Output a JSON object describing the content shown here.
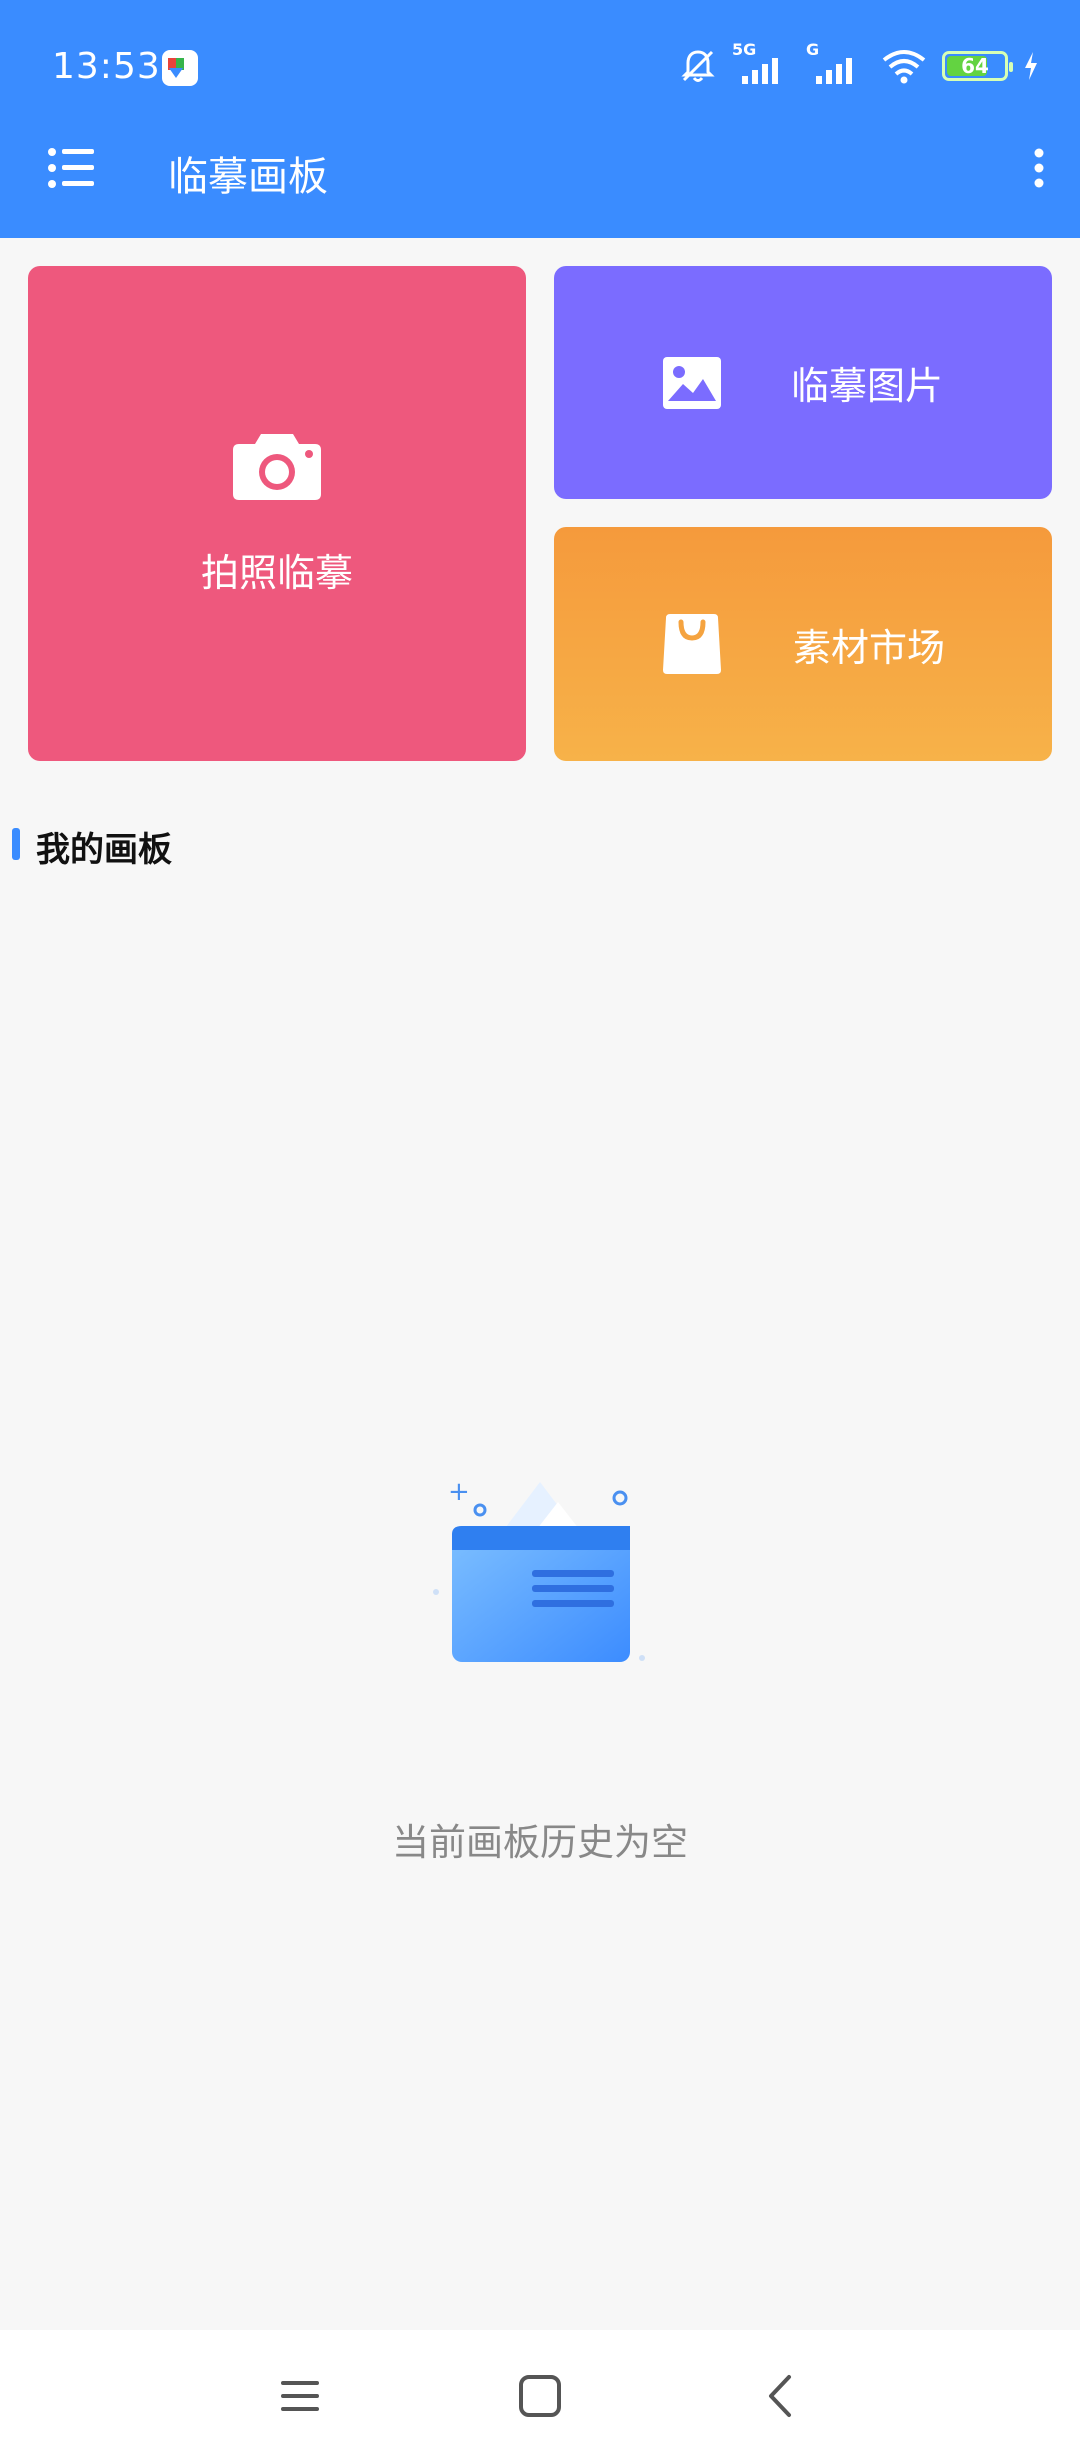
{
  "status_bar": {
    "time": "13:53",
    "network_primary": "5G",
    "network_secondary": "G",
    "battery_level": "64",
    "icons": [
      "app-notification-icon",
      "mute-bell-icon",
      "signal-icon",
      "wifi-icon",
      "battery-icon",
      "charging-icon"
    ]
  },
  "app_bar": {
    "title": "临摹画板",
    "menu_icon": "list-menu-icon",
    "more_icon": "more-vertical-icon"
  },
  "cards": {
    "camera_label": "拍照临摹",
    "image_label": "临摹图片",
    "market_label": "素材市场"
  },
  "section": {
    "title": "我的画板"
  },
  "empty_state": {
    "message": "当前画板历史为空"
  },
  "nav_bar": {
    "icons": [
      "recents-icon",
      "home-icon",
      "back-icon"
    ]
  },
  "colors": {
    "primary": "#3a8cff",
    "camera_card": "#ee587d",
    "image_card": "#7b6cff",
    "market_card": "#f5a33f"
  }
}
